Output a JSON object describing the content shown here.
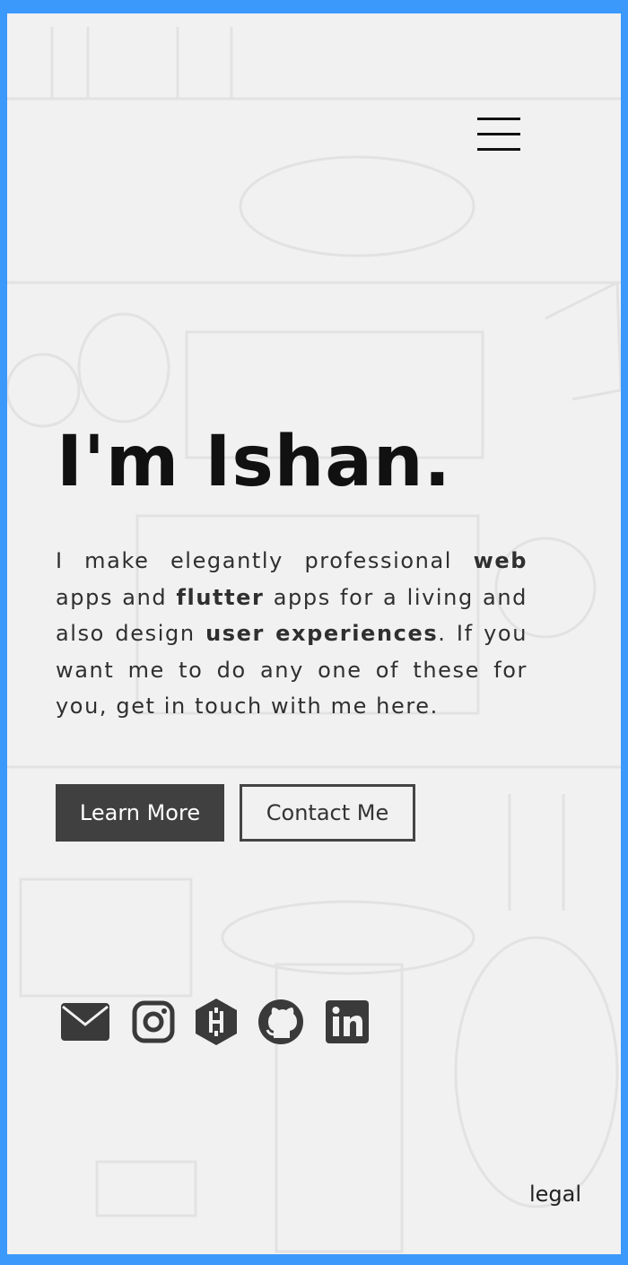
{
  "hero": {
    "title": "I'm Ishan.",
    "paragraph": {
      "t1": "I make elegantly professional ",
      "b1": "web",
      "t2": " apps and ",
      "b2": "flutter",
      "t3": " apps for a living and also design ",
      "b3": "user experiences",
      "t4": ". If you want me to do any one of these for you, get in touch with me here."
    }
  },
  "buttons": {
    "learn_more": "Learn More",
    "contact_me": "Contact Me"
  },
  "socials": [
    {
      "icon": "email-icon"
    },
    {
      "icon": "instagram-icon"
    },
    {
      "icon": "hashnode-icon"
    },
    {
      "icon": "github-icon"
    },
    {
      "icon": "linkedin-icon"
    }
  ],
  "footer": {
    "legal": "legal"
  },
  "colors": {
    "page_border": "#3b99fc",
    "background": "#f1f1f1",
    "primary_button": "#404040",
    "text": "#2f2f2f"
  }
}
